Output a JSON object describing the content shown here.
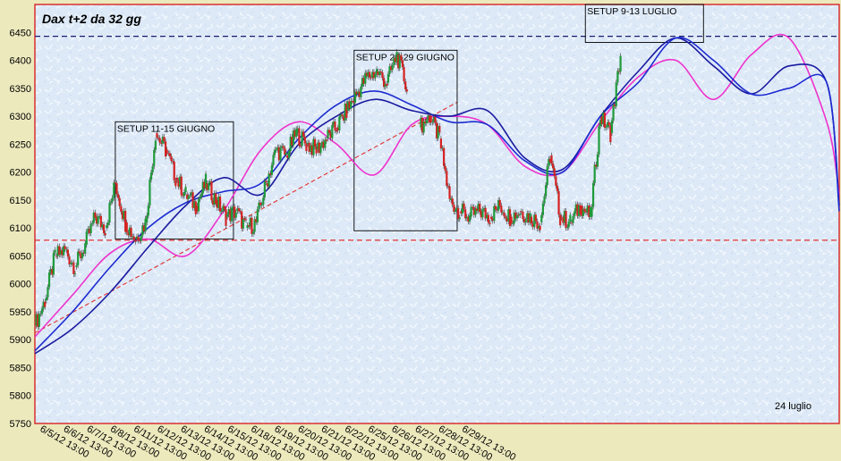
{
  "chart_data": {
    "type": "candlestick+line",
    "title": "Dax  t+2 da 32 gg",
    "ylim": [
      5750,
      6500
    ],
    "yticks": [
      5750,
      5800,
      5850,
      5900,
      5950,
      6000,
      6050,
      6100,
      6150,
      6200,
      6250,
      6300,
      6350,
      6400,
      6450
    ],
    "x_tick_labels": [
      "6/5/12 13:00",
      "6/6/12 13:00",
      "6/7/12 13:00",
      "6/8/12 13:00",
      "6/11/12 13:00",
      "6/12/12 13:00",
      "6/13/12 13:00",
      "6/14/12 13:00",
      "6/15/12 13:00",
      "6/18/12 13:00",
      "6/19/12 13:00",
      "6/20/12 13:00",
      "6/21/12 13:00",
      "6/22/12 13:00",
      "6/25/12 13:00",
      "6/26/12 13:00",
      "6/27/12 13:00",
      "6/28/12 13:00",
      "6/29/12 13:00"
    ],
    "x_range": [
      0,
      32
    ],
    "reference_lines": [
      {
        "y": 6443,
        "color": "#1a1a6e",
        "style": "dashed"
      },
      {
        "y": 6078,
        "color": "#e03030",
        "style": "dashed"
      }
    ],
    "trendline": {
      "from": [
        0,
        5912
      ],
      "to": [
        16.8,
        6325
      ],
      "color": "#e03030",
      "style": "dashed"
    },
    "price_segments": [
      {
        "x": [
          0.0,
          0.4,
          0.8,
          1.2,
          1.6,
          2.0,
          2.4,
          2.8,
          3.2,
          3.6,
          4.0,
          4.4,
          4.8,
          5.2,
          5.6,
          6.0,
          6.4,
          6.8,
          7.2,
          7.6,
          8.0,
          8.4,
          8.8,
          9.2,
          9.6,
          10.0,
          10.4,
          10.8,
          11.2,
          11.6,
          12.0,
          12.4,
          12.8,
          13.2,
          13.6,
          14.0,
          14.4,
          14.8
        ],
        "y": [
          5925,
          5970,
          6050,
          6060,
          6030,
          6070,
          6120,
          6100,
          6180,
          6110,
          6080,
          6110,
          6270,
          6240,
          6190,
          6160,
          6140,
          6180,
          6150,
          6120,
          6130,
          6100,
          6110,
          6180,
          6240,
          6230,
          6270,
          6250,
          6240,
          6260,
          6280,
          6310,
          6340,
          6370,
          6380,
          6360,
          6410,
          6350
        ]
      },
      {
        "x": [
          15.3,
          15.7,
          16.1,
          16.5,
          16.9,
          17.3,
          17.7,
          18.1,
          18.5,
          18.9,
          19.3,
          19.7,
          20.1,
          20.5,
          20.9,
          21.3,
          21.7,
          22.1,
          22.5,
          22.9,
          23.3
        ],
        "y": [
          6280,
          6300,
          6260,
          6150,
          6130,
          6120,
          6130,
          6120,
          6140,
          6120,
          6130,
          6120,
          6110,
          6230,
          6120,
          6110,
          6140,
          6120,
          6300,
          6270,
          6410
        ]
      }
    ],
    "series": [
      {
        "color": "#ee33cc",
        "x": [
          0,
          1.5,
          3,
          4.5,
          6,
          7.5,
          9,
          10.5,
          12,
          13.5,
          15,
          16.5,
          18,
          19.5,
          21,
          22.5,
          24,
          25.5,
          27,
          28.5,
          30,
          31.5,
          32
        ],
        "y": [
          5905,
          5980,
          6055,
          6080,
          6050,
          6130,
          6240,
          6290,
          6250,
          6195,
          6285,
          6300,
          6285,
          6210,
          6200,
          6290,
          6370,
          6400,
          6330,
          6410,
          6440,
          6290,
          6160
        ]
      },
      {
        "color": "#1a1aa0",
        "x": [
          0,
          1.5,
          3,
          4.5,
          6,
          7.5,
          9,
          10.5,
          12,
          13.5,
          15,
          16.5,
          18,
          19.5,
          21,
          22.5,
          24,
          25.5,
          27,
          28.5,
          30,
          31.5,
          32
        ],
        "y": [
          5875,
          5920,
          5985,
          6065,
          6140,
          6190,
          6160,
          6250,
          6300,
          6330,
          6310,
          6300,
          6310,
          6225,
          6205,
          6300,
          6380,
          6440,
          6390,
          6340,
          6390,
          6360,
          6140
        ]
      },
      {
        "color": "#1c2bd0",
        "x": [
          0,
          1.5,
          3,
          4.5,
          6,
          7.5,
          9,
          10.5,
          12,
          13.5,
          15,
          16.5,
          18,
          19.5,
          21,
          22.5,
          24,
          25.5,
          27,
          28.5,
          30,
          31.5,
          32
        ],
        "y": [
          5880,
          5950,
          6030,
          6100,
          6145,
          6165,
          6180,
          6260,
          6320,
          6345,
          6320,
          6290,
          6285,
          6220,
          6200,
          6300,
          6360,
          6440,
          6400,
          6340,
          6350,
          6360,
          6130
        ]
      }
    ],
    "annotations": [
      {
        "text": "SETUP 11-15 GIUGNO",
        "box": {
          "x": [
            3.2,
            7.9
          ],
          "y": [
            6080,
            6290
          ]
        }
      },
      {
        "text": "SETUP 25-29 GIUGNO",
        "box": {
          "x": [
            12.7,
            16.8
          ],
          "y": [
            6095,
            6418
          ]
        }
      },
      {
        "text": "SETUP 9-13 LUGLIO",
        "box": {
          "x": [
            21.9,
            26.6
          ],
          "y": [
            6432,
            6500
          ]
        }
      }
    ],
    "footer_note": "24 luglio"
  }
}
